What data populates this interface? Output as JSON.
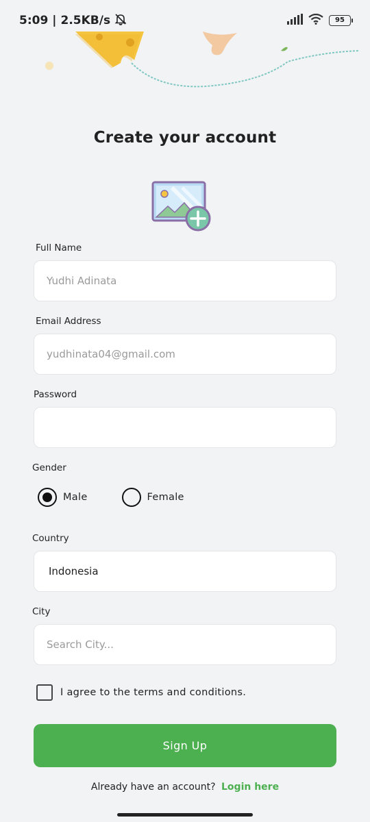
{
  "status_bar": {
    "time": "5:09",
    "network_speed": "2.5KB/s",
    "battery_level": "95",
    "icons": [
      "bell-off-icon",
      "signal-icon",
      "wifi-icon",
      "battery-icon"
    ]
  },
  "page": {
    "title": "Create your account"
  },
  "form": {
    "full_name": {
      "label": "Full Name",
      "placeholder": "Yudhi Adinata"
    },
    "email": {
      "label": "Email Address",
      "placeholder": "yudhinata04@gmail.com"
    },
    "password": {
      "label": "Password",
      "value": ""
    },
    "gender": {
      "label": "Gender",
      "options": [
        {
          "label": "Male",
          "selected": true
        },
        {
          "label": "Female",
          "selected": false
        }
      ]
    },
    "country": {
      "label": "Country",
      "value": "Indonesia"
    },
    "city": {
      "label": "City",
      "placeholder": "Search City..."
    },
    "terms": {
      "label": "I agree to the terms and conditions.",
      "checked": false
    }
  },
  "actions": {
    "signup_label": "Sign Up",
    "login_prompt": "Already have an account?",
    "login_link": "Login here"
  },
  "colors": {
    "background": "#f2f3f5",
    "accent": "#4caf50",
    "input_bg": "#ffffff"
  }
}
